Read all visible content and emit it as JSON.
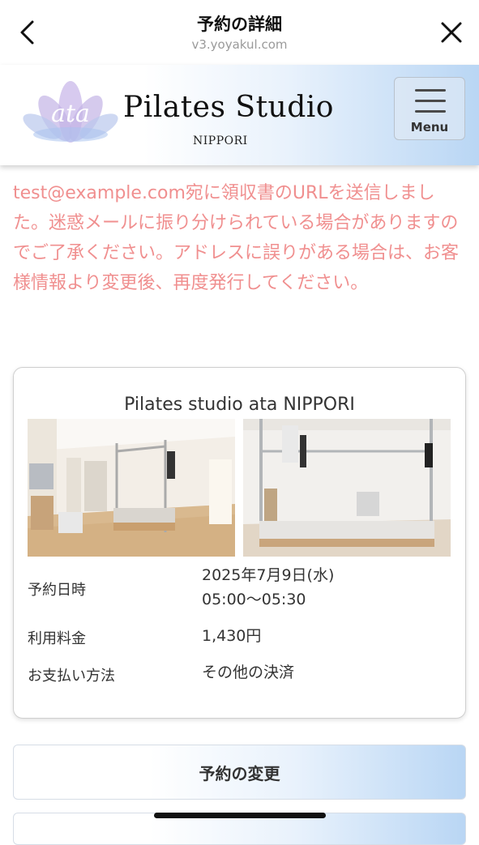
{
  "header": {
    "title": "予約の詳細",
    "url": "v3.yoyakul.com"
  },
  "site": {
    "logo_mark_text": "ata",
    "logo_text": "Pilates Studio",
    "logo_subtext": "NIPPORI",
    "menu_label": "Menu",
    "brand_colors": {
      "lotus": "#b9a6e0",
      "banner_blue": "#b9d6f4"
    }
  },
  "notice": {
    "text": "test@example.com宛に領収書のURLを送信しました。迷惑メールに振り分けられている場合がありますのでご了承ください。アドレスに誤りがある場合は、お客様情報より変更後、再度発行してください。",
    "color": "#f08f8f"
  },
  "card": {
    "studio_name": "Pilates studio ata NIPPORI",
    "photos": [
      "studio-room-photo",
      "reformer-machine-photo"
    ],
    "rows": [
      {
        "label": "予約日時",
        "value_line1": "2025年7月9日(水)",
        "value_line2": "05:00〜05:30"
      },
      {
        "label": "利用料金",
        "value_line1": "1,430円"
      },
      {
        "label": "お支払い方法",
        "value_line1": "その他の決済"
      }
    ]
  },
  "actions": {
    "change_label": "予約の変更"
  }
}
